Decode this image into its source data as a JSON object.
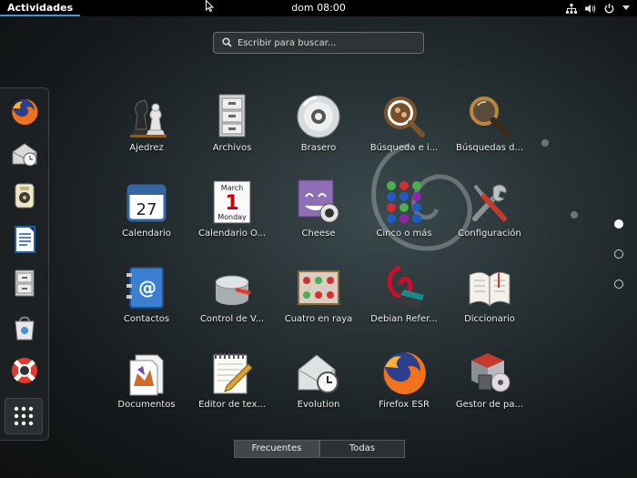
{
  "topbar": {
    "activities_label": "Actividades",
    "clock": "dom 08:00",
    "tray_icons": [
      "network-icon",
      "volume-icon",
      "power-icon",
      "chevron-down-icon"
    ]
  },
  "search": {
    "placeholder": "Escribir para buscar...",
    "value": ""
  },
  "dash": {
    "items": [
      {
        "name": "firefox",
        "icon": "firefox-icon"
      },
      {
        "name": "evolution",
        "icon": "evolution-icon"
      },
      {
        "name": "rhythmbox",
        "icon": "rhythmbox-icon"
      },
      {
        "name": "writer",
        "icon": "writer-icon"
      },
      {
        "name": "archivos",
        "icon": "files-icon"
      },
      {
        "name": "software",
        "icon": "software-icon"
      },
      {
        "name": "ayuda",
        "icon": "help-icon"
      },
      {
        "name": "mostrar-aplicaciones",
        "icon": "grid-icon"
      }
    ]
  },
  "apps": [
    {
      "label": "Ajedrez",
      "icon": "chess-icon"
    },
    {
      "label": "Archivos",
      "icon": "files-icon"
    },
    {
      "label": "Brasero",
      "icon": "brasero-icon"
    },
    {
      "label": "Búsqueda e i...",
      "icon": "search-tool-icon"
    },
    {
      "label": "Búsquedas d...",
      "icon": "magnifier-icon"
    },
    {
      "label": "Calendario",
      "icon": "calendar-icon"
    },
    {
      "label": "Calendario O...",
      "icon": "calendar-orage-icon"
    },
    {
      "label": "Cheese",
      "icon": "cheese-icon"
    },
    {
      "label": "Cinco o más",
      "icon": "five-or-more-icon"
    },
    {
      "label": "Configuración",
      "icon": "settings-icon"
    },
    {
      "label": "Contactos",
      "icon": "contacts-icon"
    },
    {
      "label": "Control de V...",
      "icon": "volume-control-icon"
    },
    {
      "label": "Cuatro en raya",
      "icon": "four-in-a-row-icon"
    },
    {
      "label": "Debian Refer...",
      "icon": "debian-reference-icon"
    },
    {
      "label": "Diccionario",
      "icon": "dictionary-icon"
    },
    {
      "label": "Documentos",
      "icon": "documents-icon"
    },
    {
      "label": "Editor de tex...",
      "icon": "text-editor-icon"
    },
    {
      "label": "Evolution",
      "icon": "evolution-icon"
    },
    {
      "label": "Firefox ESR",
      "icon": "firefox-icon"
    },
    {
      "label": "Gestor de pa...",
      "icon": "package-manager-icon"
    }
  ],
  "calendar_icon": {
    "month": "March",
    "day": "1",
    "weekday": "Monday",
    "small_day": "27"
  },
  "pages": {
    "count": 3,
    "current": 1
  },
  "tabs": [
    {
      "label": "Frecuentes",
      "active": true
    },
    {
      "label": "Todas",
      "active": false
    }
  ]
}
